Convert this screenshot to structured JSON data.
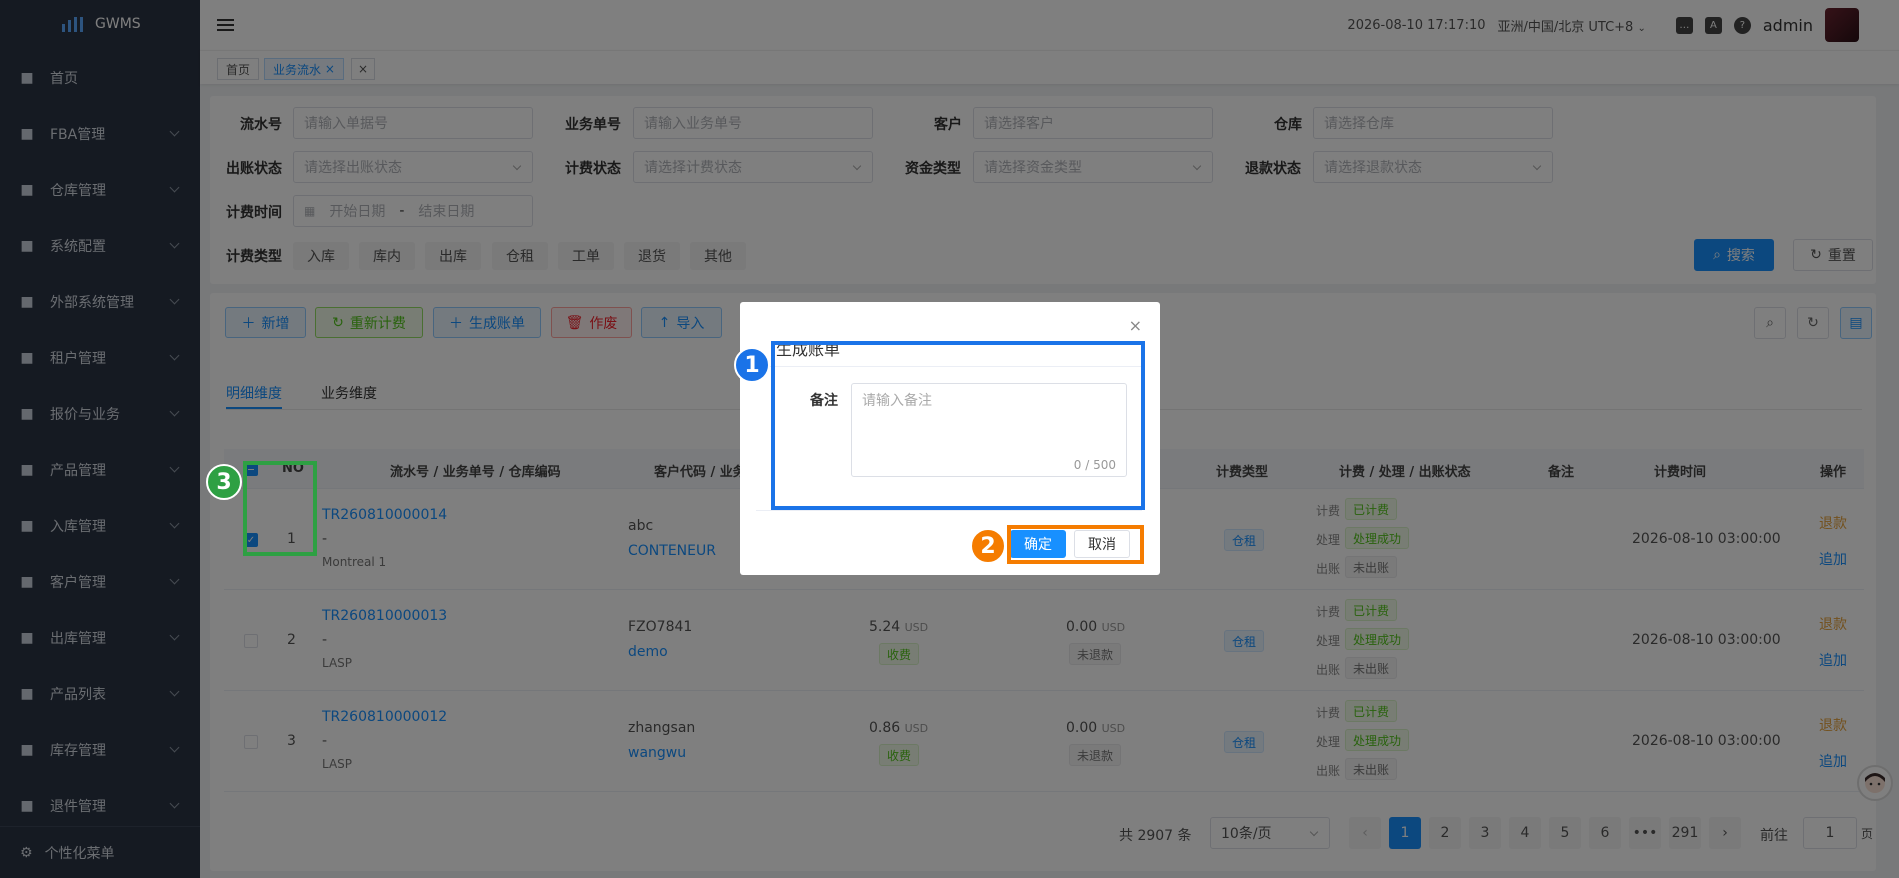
{
  "app": {
    "name": "GWMS"
  },
  "sidebar": {
    "items": [
      {
        "label": "首页",
        "icon": "dashboard-icon"
      },
      {
        "label": "FBA管理",
        "icon": "fba-icon"
      },
      {
        "label": "仓库管理",
        "icon": "warehouse-icon"
      },
      {
        "label": "系统配置",
        "icon": "settings-icon"
      },
      {
        "label": "外部系统管理",
        "icon": "grid-icon"
      },
      {
        "label": "租户管理",
        "icon": "chart-icon"
      },
      {
        "label": "报价与业务",
        "icon": "quote-icon"
      },
      {
        "label": "产品管理",
        "icon": "cart-icon"
      },
      {
        "label": "入库管理",
        "icon": "home-icon"
      },
      {
        "label": "客户管理",
        "icon": "user-icon"
      },
      {
        "label": "出库管理",
        "icon": "grid-icon"
      },
      {
        "label": "产品列表",
        "icon": "book-icon"
      },
      {
        "label": "库存管理",
        "icon": "table-icon"
      },
      {
        "label": "退件管理",
        "icon": "return-icon"
      }
    ],
    "footer_label": "个性化菜单"
  },
  "header": {
    "datetime": "2026-08-10 17:17:10",
    "timezone": "亚洲/中国/北京 UTC+8",
    "username": "admin",
    "lang_icon_text": "A"
  },
  "tabs": [
    {
      "label": "首页"
    },
    {
      "label": "业务流水",
      "close": "×"
    },
    {
      "label": "×"
    }
  ],
  "filters": {
    "serial_no": {
      "label": "流水号",
      "placeholder": "请输入单据号"
    },
    "business_no": {
      "label": "业务单号",
      "placeholder": "请输入业务单号"
    },
    "customer": {
      "label": "客户",
      "placeholder": "请选择客户"
    },
    "warehouse": {
      "label": "仓库",
      "placeholder": "请选择仓库"
    },
    "billing_status": {
      "label": "出账状态",
      "placeholder": "请选择出账状态"
    },
    "charge_status": {
      "label": "计费状态",
      "placeholder": "请选择计费状态"
    },
    "fund_type": {
      "label": "资金类型",
      "placeholder": "请选择资金类型"
    },
    "refund_status": {
      "label": "退款状态",
      "placeholder": "请选择退款状态"
    },
    "charge_time": {
      "label": "计费时间",
      "start": "开始日期",
      "sep": "-",
      "end": "结束日期"
    },
    "charge_type": {
      "label": "计费类型",
      "chips": [
        "入库",
        "库内",
        "出库",
        "仓租",
        "工单",
        "退货",
        "其他"
      ]
    },
    "search_label": "搜索",
    "reset_label": "重置"
  },
  "toolbar": {
    "add": "新增",
    "recharge": "重新计费",
    "gen_bill": "生成账单",
    "void": "作废",
    "import": "导入"
  },
  "dimension_tabs": [
    "明细维度",
    "业务维度"
  ],
  "table": {
    "columns": [
      "NO",
      "流水号 / 业务单号 / 仓库编码",
      "客户代码 / 业务",
      "计费类型",
      "计费 / 处理 / 出账状态",
      "备注",
      "计费时间",
      "操作"
    ],
    "status_labels": [
      "计费",
      "处理",
      "出账"
    ],
    "rows": [
      {
        "no": "1",
        "serial": "TR260810000014",
        "biz": "-",
        "wh": "Montreal 1",
        "cust_code": "abc",
        "cust_name": "CONTENEUR",
        "amount": "",
        "currency": "",
        "fund_tag": "",
        "refund": "",
        "refund_currency": "",
        "refund_tag": "",
        "charge_type": "仓租",
        "s1": "已计费",
        "s2": "处理成功",
        "s3": "未出账",
        "time": "2026-08-10 03:00:00",
        "op1": "退款",
        "op2": "追加",
        "checked": true
      },
      {
        "no": "2",
        "serial": "TR260810000013",
        "biz": "-",
        "wh": "LASP",
        "cust_code": "FZO7841",
        "cust_name": "demo",
        "amount": "5.24",
        "currency": "USD",
        "fund_tag": "收费",
        "refund": "0.00",
        "refund_currency": "USD",
        "refund_tag": "未退款",
        "charge_type": "仓租",
        "s1": "已计费",
        "s2": "处理成功",
        "s3": "未出账",
        "time": "2026-08-10 03:00:00",
        "op1": "退款",
        "op2": "追加",
        "checked": false
      },
      {
        "no": "3",
        "serial": "TR260810000012",
        "biz": "-",
        "wh": "LASP",
        "cust_code": "zhangsan",
        "cust_name": "wangwu",
        "amount": "0.86",
        "currency": "USD",
        "fund_tag": "收费",
        "refund": "0.00",
        "refund_currency": "USD",
        "refund_tag": "未退款",
        "charge_type": "仓租",
        "s1": "已计费",
        "s2": "处理成功",
        "s3": "未出账",
        "time": "2026-08-10 03:00:00",
        "op1": "退款",
        "op2": "追加",
        "checked": false
      }
    ]
  },
  "pagination": {
    "total": "共 2907 条",
    "page_size": "10条/页",
    "pages": [
      "1",
      "2",
      "3",
      "4",
      "5",
      "6",
      "•••",
      "291"
    ],
    "goto_label": "前往",
    "goto_value": "1",
    "page_unit": "页",
    "prev": "‹",
    "next": "›"
  },
  "modal": {
    "title": "生成账单",
    "remark_label": "备注",
    "remark_placeholder": "请输入备注",
    "counter": "0 / 500",
    "confirm": "确定",
    "cancel": "取消",
    "close": "×"
  },
  "annotations": [
    {
      "label": "1",
      "color": "#1a73e8"
    },
    {
      "label": "2",
      "color": "#f57c00"
    },
    {
      "label": "3",
      "color": "#2ea043"
    }
  ]
}
